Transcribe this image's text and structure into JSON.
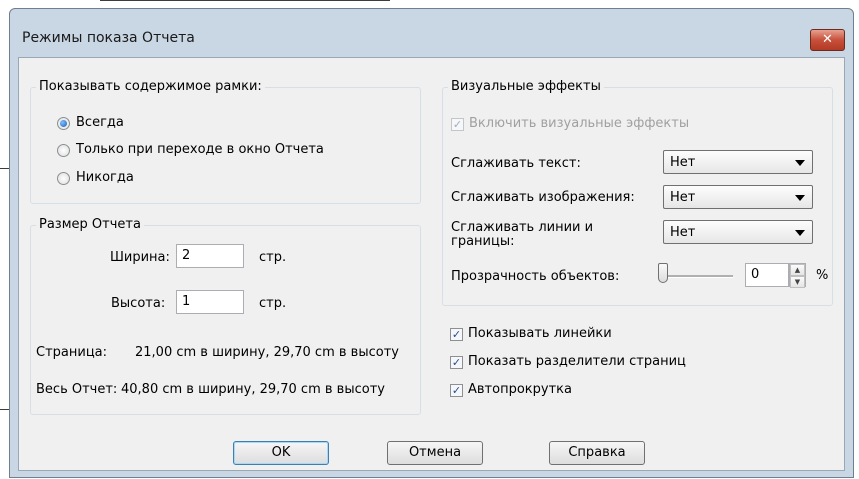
{
  "window": {
    "title": "Режимы показа Отчета",
    "close_glyph": "✕"
  },
  "frame_content": {
    "title": "Показывать содержимое рамки:",
    "options": [
      {
        "label": "Всегда",
        "selected": true
      },
      {
        "label": "Только при переходе в окно Отчета",
        "selected": false
      },
      {
        "label": "Никогда",
        "selected": false
      }
    ]
  },
  "report_size": {
    "title": "Размер Отчета",
    "width_label": "Ширина:",
    "width_value": "2",
    "width_unit": "стр.",
    "height_label": "Высота:",
    "height_value": "1",
    "height_unit": "стр.",
    "page_label": "Страница:",
    "page_value": "21,00 cm в ширину, 29,70 cm в высоту",
    "total_label": "Весь Отчет:",
    "total_value": "40,80 cm в ширину, 29,70 cm в высоту"
  },
  "visual_effects": {
    "title": "Визуальные эффекты",
    "enable_label": "Включить визуальные эффекты",
    "enable_checked": true,
    "enable_disabled": true,
    "smooth_text_label": "Сглаживать текст:",
    "smooth_text_value": "Нет",
    "smooth_images_label": "Сглаживать изображения:",
    "smooth_images_value": "Нет",
    "smooth_lines_label": "Сглаживать линии и границы:",
    "smooth_lines_value": "Нет",
    "transparency_label": "Прозрачность объектов:",
    "transparency_value": "0",
    "transparency_unit": "%"
  },
  "options": [
    {
      "label": "Показывать линейки",
      "checked": true
    },
    {
      "label": "Показать разделители страниц",
      "checked": true
    },
    {
      "label": "Автопрокрутка",
      "checked": true
    }
  ],
  "buttons": {
    "ok": "OK",
    "cancel": "Отмена",
    "help": "Справка"
  },
  "icons": {
    "radio_selected": "radio-selected-icon",
    "check": "✓",
    "spin_up": "▲",
    "spin_down": "▼"
  },
  "colors": {
    "titlebar": "#c9d6e3",
    "client": "#f0f0f0",
    "close": "#c7503c",
    "accent": "#1c5cb4"
  }
}
